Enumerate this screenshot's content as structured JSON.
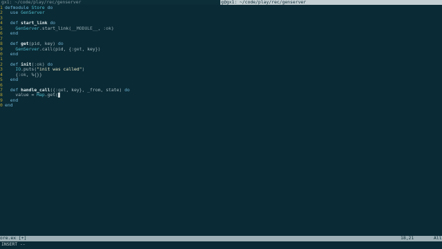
{
  "titlebar": {
    "left_tab": "gx1: ~/code/play/rec/genserver",
    "right_tab": "g@gx1: ~/code/play/rec/genserver"
  },
  "editor": {
    "lines": [
      {
        "num": "1",
        "text": "defmodule Store do"
      },
      {
        "num": "2",
        "text": "  use GenServer"
      },
      {
        "num": "3",
        "text": ""
      },
      {
        "num": "4",
        "text": "  def start_link do"
      },
      {
        "num": "5",
        "text": "    GenServer.start_link(__MODULE__, :ok)"
      },
      {
        "num": "6",
        "text": "  end"
      },
      {
        "num": "7",
        "text": ""
      },
      {
        "num": "8",
        "text": "  def get(pid, key) do"
      },
      {
        "num": "9",
        "text": "    GenServer.call(pid, {:get, key})"
      },
      {
        "num": "0",
        "text": "  end"
      },
      {
        "num": "1",
        "text": ""
      },
      {
        "num": "2",
        "text": "  def init(:ok) do"
      },
      {
        "num": "3",
        "text": "    IO.puts(\"init was called\")"
      },
      {
        "num": "4",
        "text": "    {:ok, %{}}"
      },
      {
        "num": "5",
        "text": "  end"
      },
      {
        "num": "6",
        "text": ""
      },
      {
        "num": "7",
        "text": "  def handle_call({:get, key}, _from, state) do"
      },
      {
        "num": "8",
        "text": "    value = Map.get("
      },
      {
        "num": "9",
        "text": "  end"
      },
      {
        "num": "0",
        "text": "end"
      }
    ]
  },
  "statusbar": {
    "filename": "ore.ex [+]",
    "position": "18,21",
    "percent": "All"
  },
  "modeline": {
    "mode": "INSERT --"
  }
}
